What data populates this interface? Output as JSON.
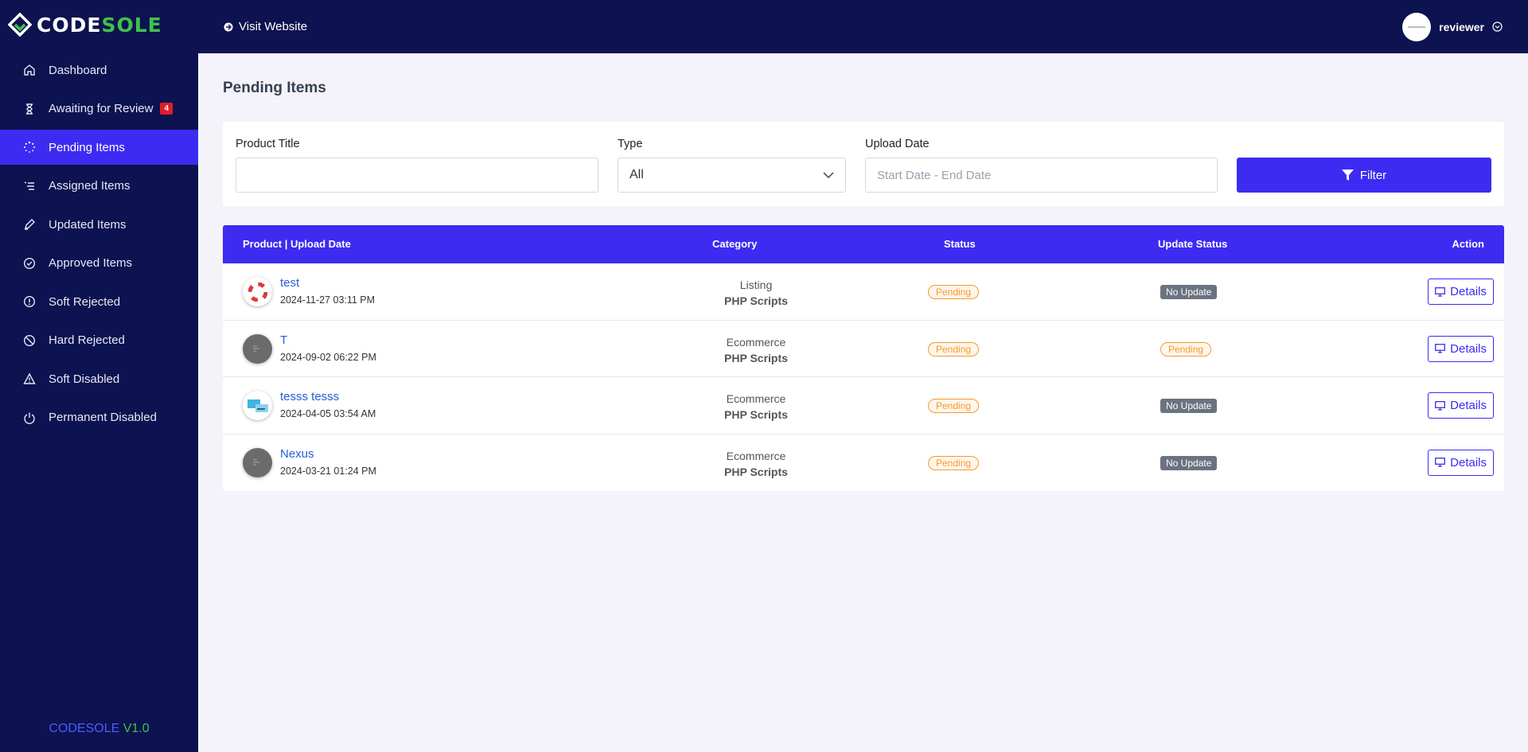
{
  "brand": {
    "logo_part1": "CODE",
    "logo_part2": "SOLE",
    "version_brand": "CODESOLE",
    "version_num": "V1.0"
  },
  "sidebar": {
    "items": [
      {
        "label": "Dashboard",
        "icon": "home-icon"
      },
      {
        "label": "Awaiting for Review",
        "icon": "hourglass-icon",
        "badge": "4"
      },
      {
        "label": "Pending Items",
        "icon": "spinner-icon",
        "active": true
      },
      {
        "label": "Assigned Items",
        "icon": "list-icon"
      },
      {
        "label": "Updated Items",
        "icon": "pencil-icon"
      },
      {
        "label": "Approved Items",
        "icon": "check-circle-icon"
      },
      {
        "label": "Soft Rejected",
        "icon": "info-circle-icon"
      },
      {
        "label": "Hard Rejected",
        "icon": "ban-icon"
      },
      {
        "label": "Soft Disabled",
        "icon": "warning-icon"
      },
      {
        "label": "Permanent Disabled",
        "icon": "power-icon"
      }
    ]
  },
  "topbar": {
    "visit_label": "Visit Website",
    "username": "reviewer"
  },
  "page": {
    "title": "Pending Items"
  },
  "filter": {
    "product_title_label": "Product Title",
    "product_title_value": "",
    "type_label": "Type",
    "type_value": "All",
    "upload_date_label": "Upload Date",
    "upload_date_placeholder": "Start Date - End Date",
    "filter_button": "Filter"
  },
  "table": {
    "headers": {
      "product": "Product | Upload Date",
      "category": "Category",
      "status": "Status",
      "update_status": "Update Status",
      "action": "Action"
    },
    "rows": [
      {
        "name": "test",
        "date": "2024-11-27 03:11 PM",
        "category": "Listing",
        "subcategory": "PHP Scripts",
        "status": "Pending",
        "update_status": "No Update",
        "action": "Details"
      },
      {
        "name": "T",
        "date": "2024-09-02 06:22 PM",
        "category": "Ecommerce",
        "subcategory": "PHP Scripts",
        "status": "Pending",
        "update_status": "Pending",
        "action": "Details"
      },
      {
        "name": "tesss tesss",
        "date": "2024-04-05 03:54 AM",
        "category": "Ecommerce",
        "subcategory": "PHP Scripts",
        "status": "Pending",
        "update_status": "No Update",
        "action": "Details"
      },
      {
        "name": "Nexus",
        "date": "2024-03-21 01:24 PM",
        "category": "Ecommerce",
        "subcategory": "PHP Scripts",
        "status": "Pending",
        "update_status": "No Update",
        "action": "Details"
      }
    ]
  },
  "colors": {
    "sidebar_bg": "#0d1250",
    "accent": "#3d2bf2",
    "pending": "#f59a2e",
    "no_update": "#6b7280",
    "badge": "#e11d2a"
  }
}
